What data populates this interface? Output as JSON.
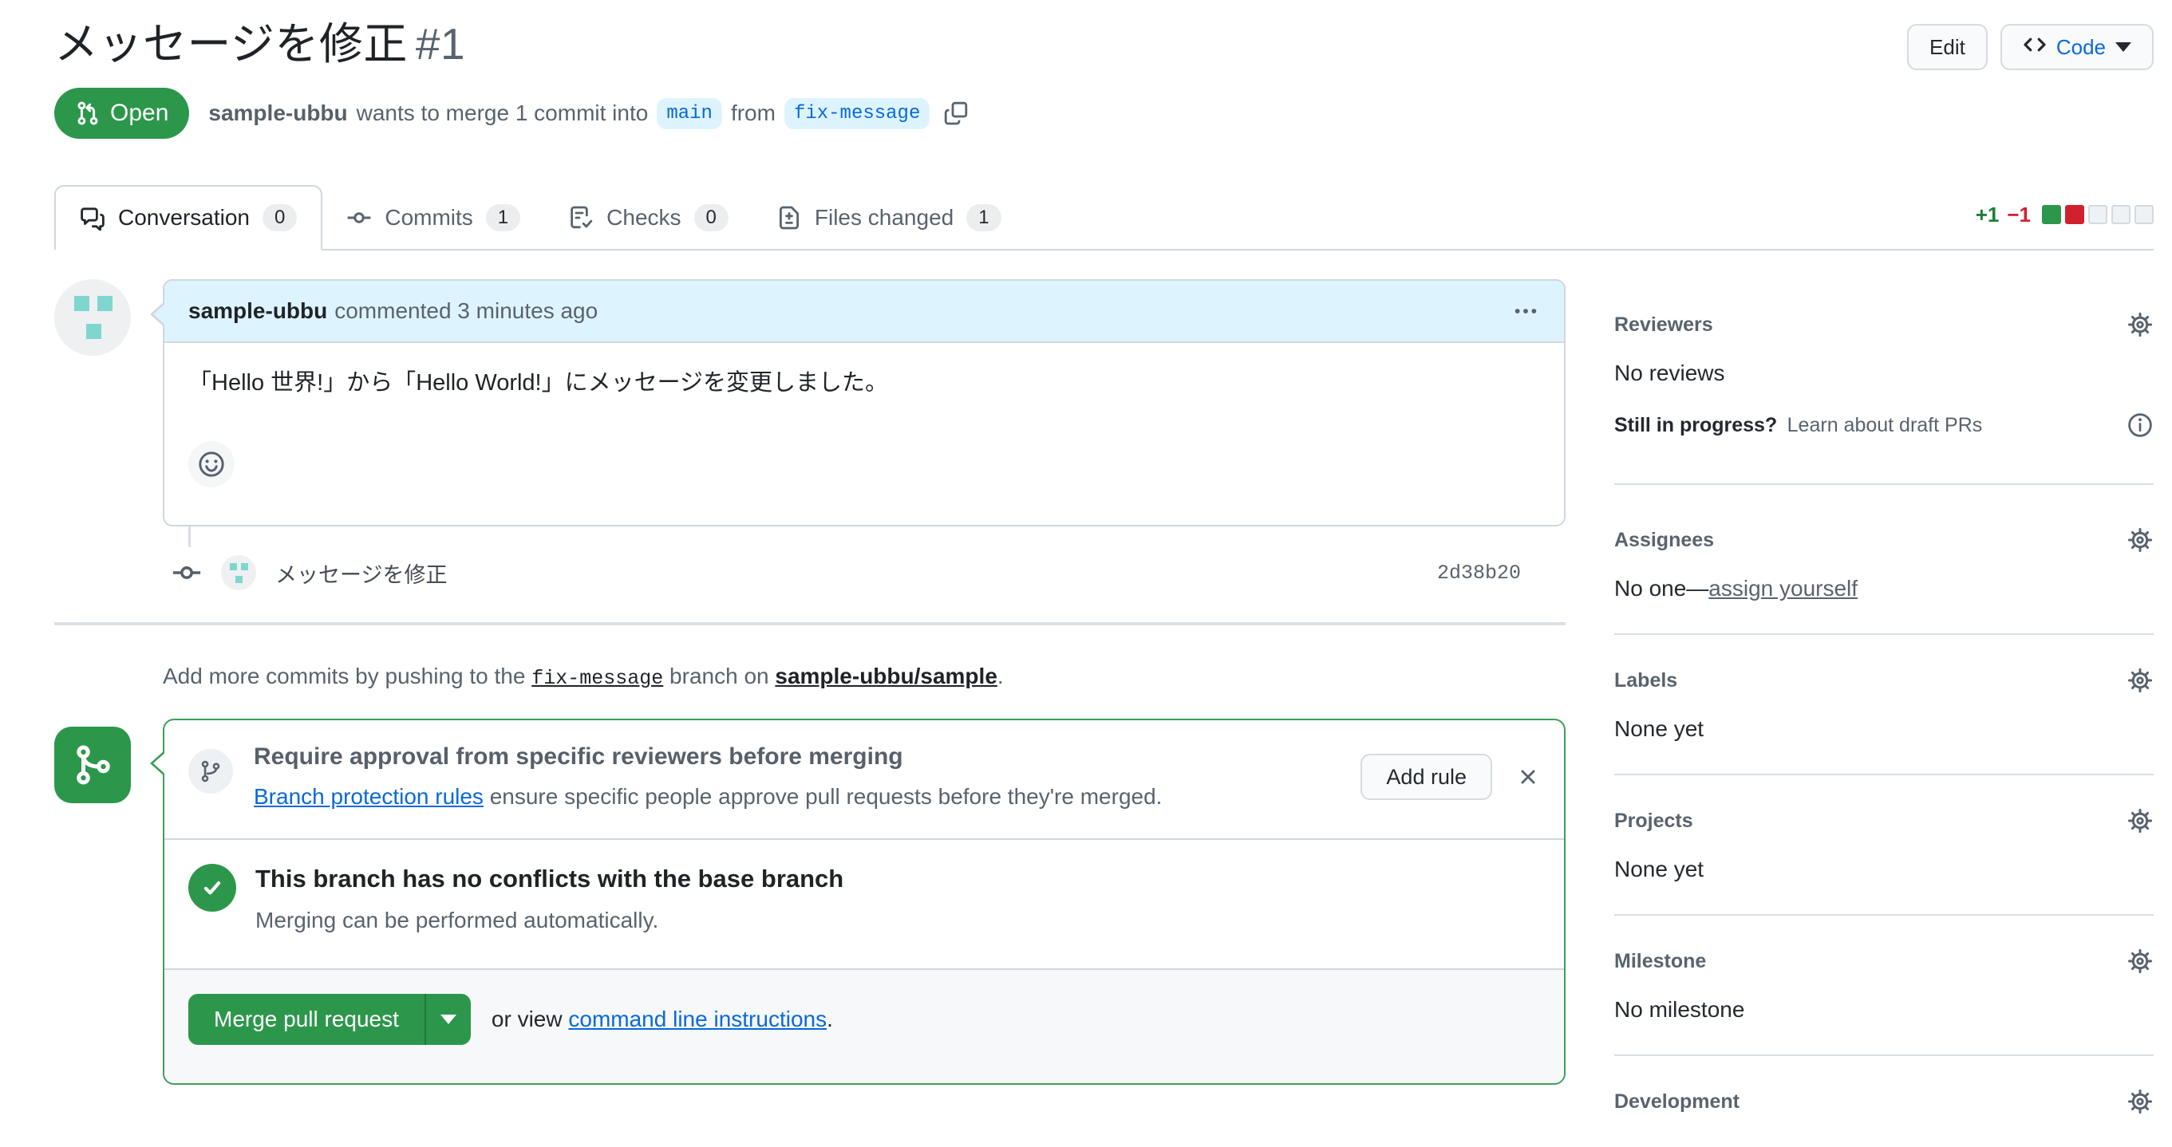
{
  "header": {
    "title": "メッセージを修正",
    "number": "#1",
    "edit_button": "Edit",
    "code_button": "Code"
  },
  "status_bar": {
    "state_label": "Open",
    "author": "sample-ubbu",
    "merge_phrase": "wants to merge 1 commit into",
    "base_branch": "main",
    "from_word": "from",
    "head_branch": "fix-message"
  },
  "tabs": [
    {
      "label": "Conversation",
      "count": "0"
    },
    {
      "label": "Commits",
      "count": "1"
    },
    {
      "label": "Checks",
      "count": "0"
    },
    {
      "label": "Files changed",
      "count": "1"
    }
  ],
  "diffstat": {
    "additions": "+1",
    "deletions": "−1",
    "blocks": [
      "addition",
      "deletion",
      "neutral",
      "neutral",
      "neutral"
    ]
  },
  "comment": {
    "author": "sample-ubbu",
    "action": "commented 3 minutes ago",
    "body": "「Hello 世界!」から「Hello World!」にメッセージを変更しました。"
  },
  "commit": {
    "message": "メッセージを修正",
    "sha": "2d38b20"
  },
  "push_hint": {
    "prefix": "Add more commits by pushing to the",
    "branch": "fix-message",
    "middle": "branch on",
    "repo": "sample-ubbu/sample",
    "suffix": "."
  },
  "merge_box": {
    "rule": {
      "title": "Require approval from specific reviewers before merging",
      "link": "Branch protection rules",
      "description": "ensure specific people approve pull requests before they're merged.",
      "add_rule_button": "Add rule"
    },
    "mergeability": {
      "title": "This branch has no conflicts with the base branch",
      "subtitle": "Merging can be performed automatically."
    },
    "actions": {
      "merge_button": "Merge pull request",
      "or_view": "or view",
      "cli_link": "command line instructions",
      "period": "."
    }
  },
  "sidebar": {
    "reviewers": {
      "heading": "Reviewers",
      "empty": "No reviews",
      "draft_bold": "Still in progress?",
      "draft_link": "Learn about draft PRs"
    },
    "assignees": {
      "heading": "Assignees",
      "empty_prefix": "No one—",
      "self_assign_link": "assign yourself"
    },
    "labels": {
      "heading": "Labels",
      "empty": "None yet"
    },
    "projects": {
      "heading": "Projects",
      "empty": "None yet"
    },
    "milestone": {
      "heading": "Milestone",
      "empty": "No milestone"
    },
    "development": {
      "heading": "Development"
    }
  },
  "colors": {
    "open_green": "#2c974b",
    "link_blue": "#0969da",
    "additions_green": "#1a7f37",
    "deletions_red": "#cf222e",
    "header_blue_bg": "#ddf4ff",
    "identicon_teal": "#7fd6cf"
  }
}
